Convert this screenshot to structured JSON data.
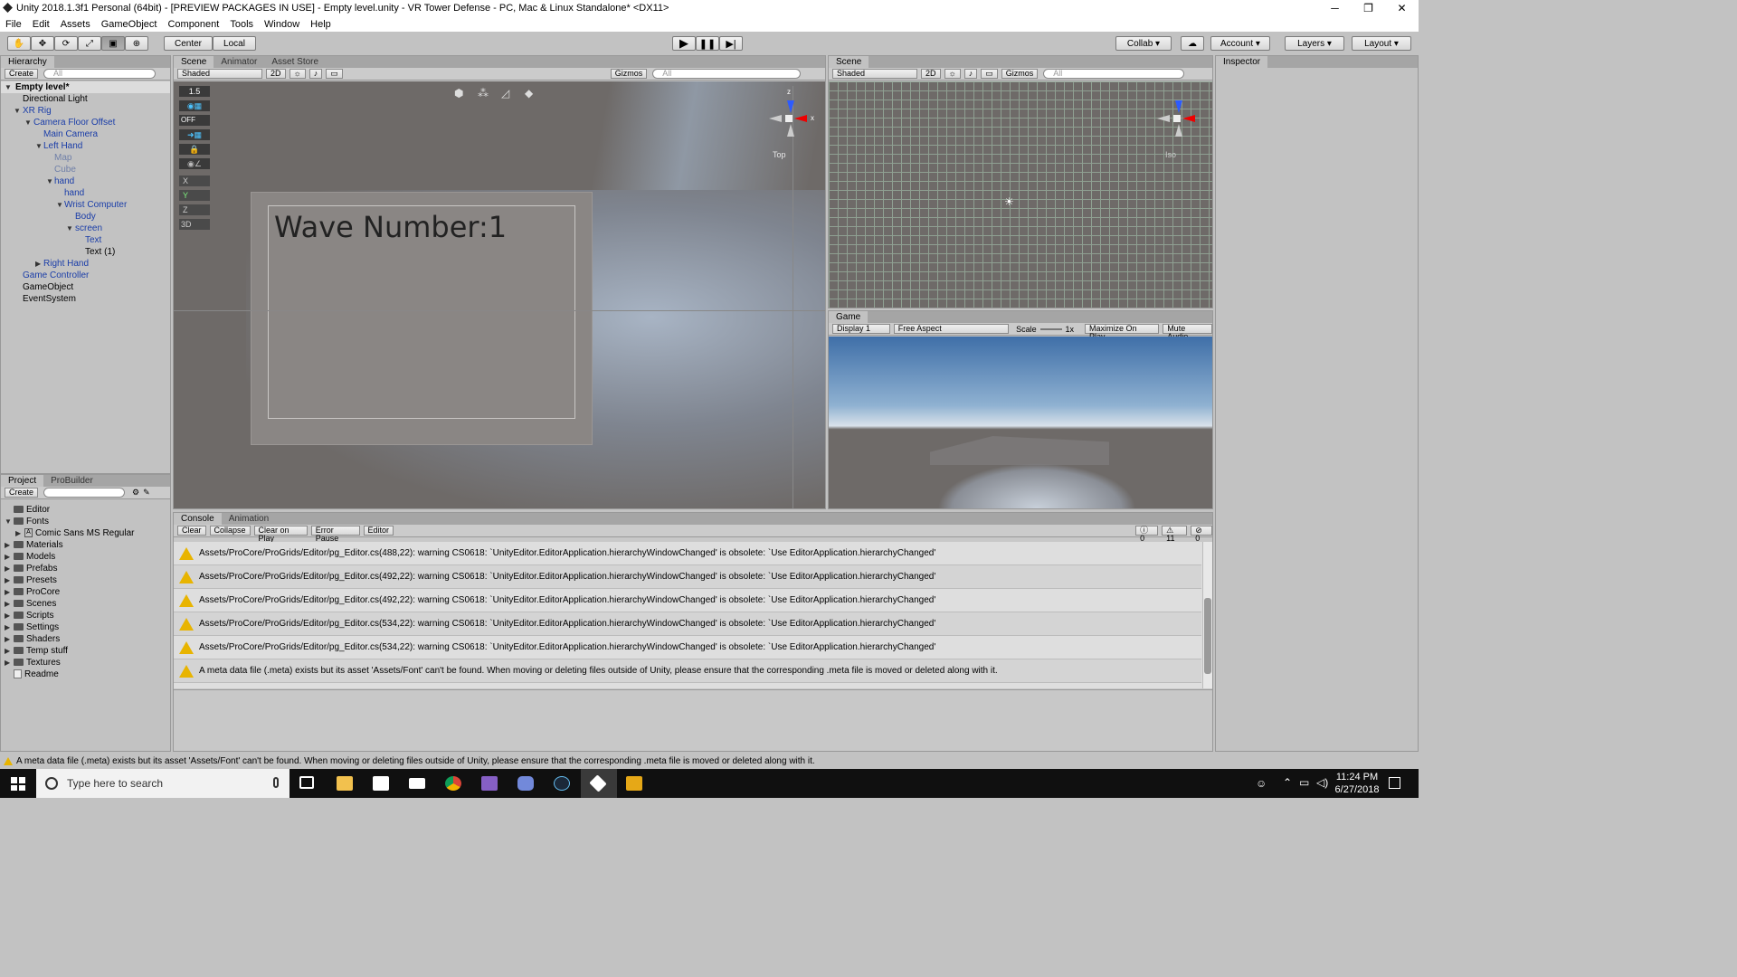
{
  "window": {
    "title": "Unity 2018.1.3f1 Personal (64bit) - [PREVIEW PACKAGES IN USE] - Empty level.unity - VR Tower Defense - PC, Mac & Linux Standalone* <DX11>",
    "minimize": "─",
    "restore": "❐",
    "close": "✕"
  },
  "menu": [
    "File",
    "Edit",
    "Assets",
    "GameObject",
    "Component",
    "Tools",
    "Window",
    "Help"
  ],
  "toolbar": {
    "center": "Center",
    "local": "Local",
    "collab": "Collab",
    "account": "Account",
    "layers": "Layers",
    "layout": "Layout",
    "play_icon": "play-icon",
    "pause_icon": "pause-icon",
    "step_icon": "step-icon"
  },
  "hierarchy": {
    "tab": "Hierarchy",
    "create": "Create",
    "search_placeholder": "All",
    "scene": "Empty level*",
    "items": [
      "Directional Light",
      "XR Rig",
      "Camera Floor Offset",
      "Main Camera",
      "Left Hand",
      "Map",
      "Cube",
      "hand",
      "hand",
      "Wrist Computer",
      "Body",
      "screen",
      "Text",
      "Text (1)",
      "Right Hand",
      "Game Controller",
      "GameObject",
      "EventSystem"
    ]
  },
  "scene_left": {
    "tabs": [
      "Scene",
      "Animator",
      "Asset Store"
    ],
    "shaded": "Shaded",
    "mode2d": "2D",
    "gizmos": "Gizmos",
    "search": "All",
    "view_label": "Top",
    "grid_size": "1.5",
    "off": "OFF",
    "axes": [
      "X",
      "Y",
      "Z",
      "3D"
    ],
    "canvas_text": "Wave Number:1"
  },
  "scene_right": {
    "tab": "Scene",
    "shaded": "Shaded",
    "mode2d": "2D",
    "gizmos": "Gizmos",
    "search": "All",
    "view_label": "Iso"
  },
  "inspector": {
    "tab": "Inspector"
  },
  "game": {
    "tab": "Game",
    "display": "Display 1",
    "aspect": "Free Aspect",
    "scale_label": "Scale",
    "scale_value": "1x",
    "maximize": "Maximize On Play",
    "mute": "Mute Audio"
  },
  "project": {
    "tabs": [
      "Project",
      "ProBuilder"
    ],
    "create": "Create",
    "items": [
      "Editor",
      "Fonts",
      "Comic Sans MS Regular",
      "Materials",
      "Models",
      "Prefabs",
      "Presets",
      "ProCore",
      "Scenes",
      "Scripts",
      "Settings",
      "Shaders",
      "Temp stuff",
      "Textures",
      "Readme"
    ]
  },
  "console": {
    "tabs": [
      "Console",
      "Animation"
    ],
    "buttons": [
      "Clear",
      "Collapse",
      "Clear on Play",
      "Error Pause",
      "Editor"
    ],
    "counts": {
      "info": "0",
      "warn": "11",
      "error": "0"
    },
    "messages": [
      "Assets/ProCore/ProGrids/Editor/pg_Editor.cs(488,22): warning CS0618: `UnityEditor.EditorApplication.hierarchyWindowChanged' is obsolete: `Use EditorApplication.hierarchyChanged'",
      "Assets/ProCore/ProGrids/Editor/pg_Editor.cs(492,22): warning CS0618: `UnityEditor.EditorApplication.hierarchyWindowChanged' is obsolete: `Use EditorApplication.hierarchyChanged'",
      "Assets/ProCore/ProGrids/Editor/pg_Editor.cs(492,22): warning CS0618: `UnityEditor.EditorApplication.hierarchyWindowChanged' is obsolete: `Use EditorApplication.hierarchyChanged'",
      "Assets/ProCore/ProGrids/Editor/pg_Editor.cs(534,22): warning CS0618: `UnityEditor.EditorApplication.hierarchyWindowChanged' is obsolete: `Use EditorApplication.hierarchyChanged'",
      "Assets/ProCore/ProGrids/Editor/pg_Editor.cs(534,22): warning CS0618: `UnityEditor.EditorApplication.hierarchyWindowChanged' is obsolete: `Use EditorApplication.hierarchyChanged'",
      "A meta data file (.meta) exists but its asset 'Assets/Font' can't be found. When moving or deleting files outside of Unity, please ensure that the corresponding .meta file is moved or deleted along with it."
    ]
  },
  "statusbar": {
    "text": "A meta data file (.meta) exists but its asset 'Assets/Font' can't be found. When moving or deleting files outside of Unity, please ensure that the corresponding .meta file is moved or deleted along with it."
  },
  "taskbar": {
    "search_placeholder": "Type here to search",
    "time": "11:24 PM",
    "date": "6/27/2018"
  },
  "colors": {
    "editor_bg": "#c2c2c2",
    "scene_bg": "#6e6a68",
    "taskbar": "#101010",
    "warning": "#e8b400",
    "sky_top": "#3f6fa8"
  }
}
